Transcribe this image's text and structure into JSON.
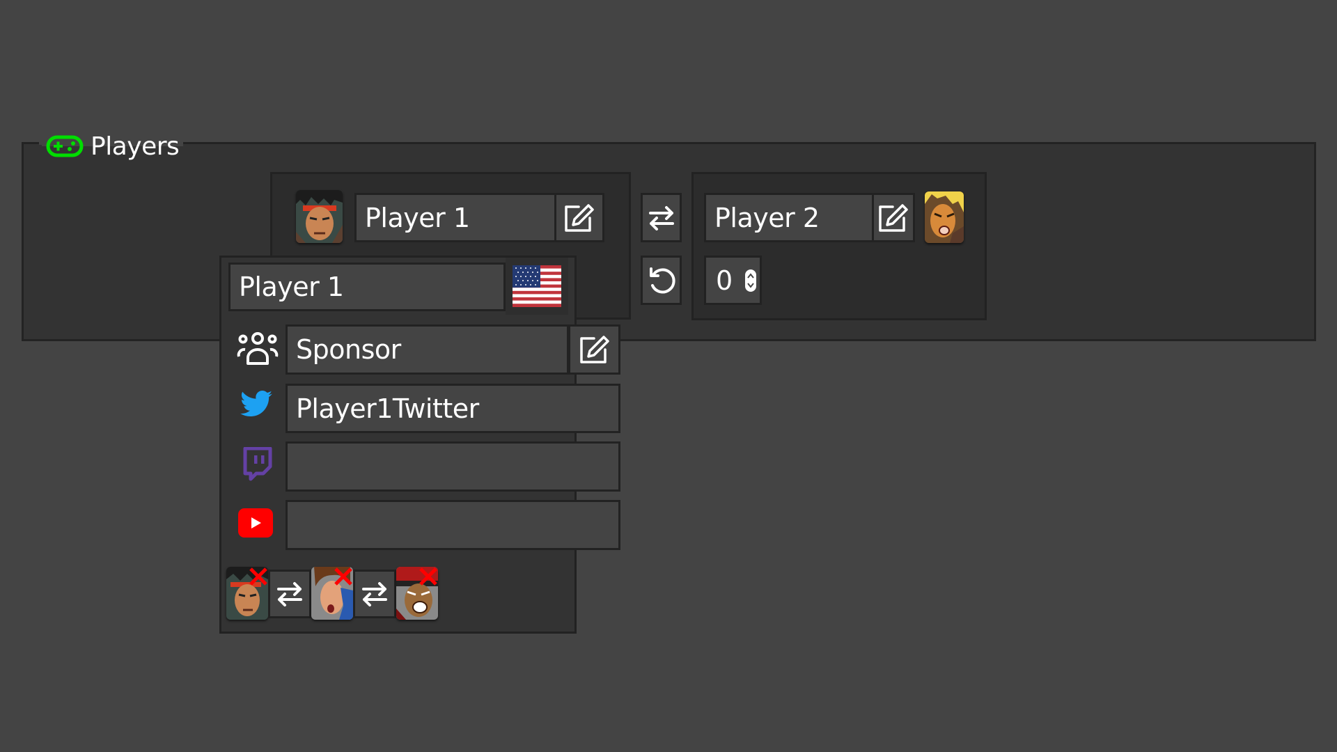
{
  "panel": {
    "title": "Players",
    "icon": "gamepad-icon",
    "accent_color": "#00dd00"
  },
  "player1": {
    "name": "Player 1",
    "character": "Ryu",
    "portrait_icon": "ryu-portrait"
  },
  "player2": {
    "name": "Player 2",
    "character": "Ken",
    "portrait_icon": "ken-portrait",
    "score": "0"
  },
  "controls": {
    "swap_icon": "swap-arrows-icon",
    "reset_icon": "reset-icon"
  },
  "popup": {
    "full_name": "Player 1",
    "country": "United States",
    "country_flag": "us-flag-icon",
    "sponsor": "Sponsor",
    "twitter": "Player1Twitter",
    "twitch": "",
    "youtube": "",
    "colors": {
      "twitter": "#1da1f2",
      "twitch": "#6441a5",
      "youtube": "#ff0000"
    },
    "characters": [
      {
        "name": "Ryu"
      },
      {
        "name": "Chun-Li"
      },
      {
        "name": "M. Bison"
      }
    ]
  }
}
